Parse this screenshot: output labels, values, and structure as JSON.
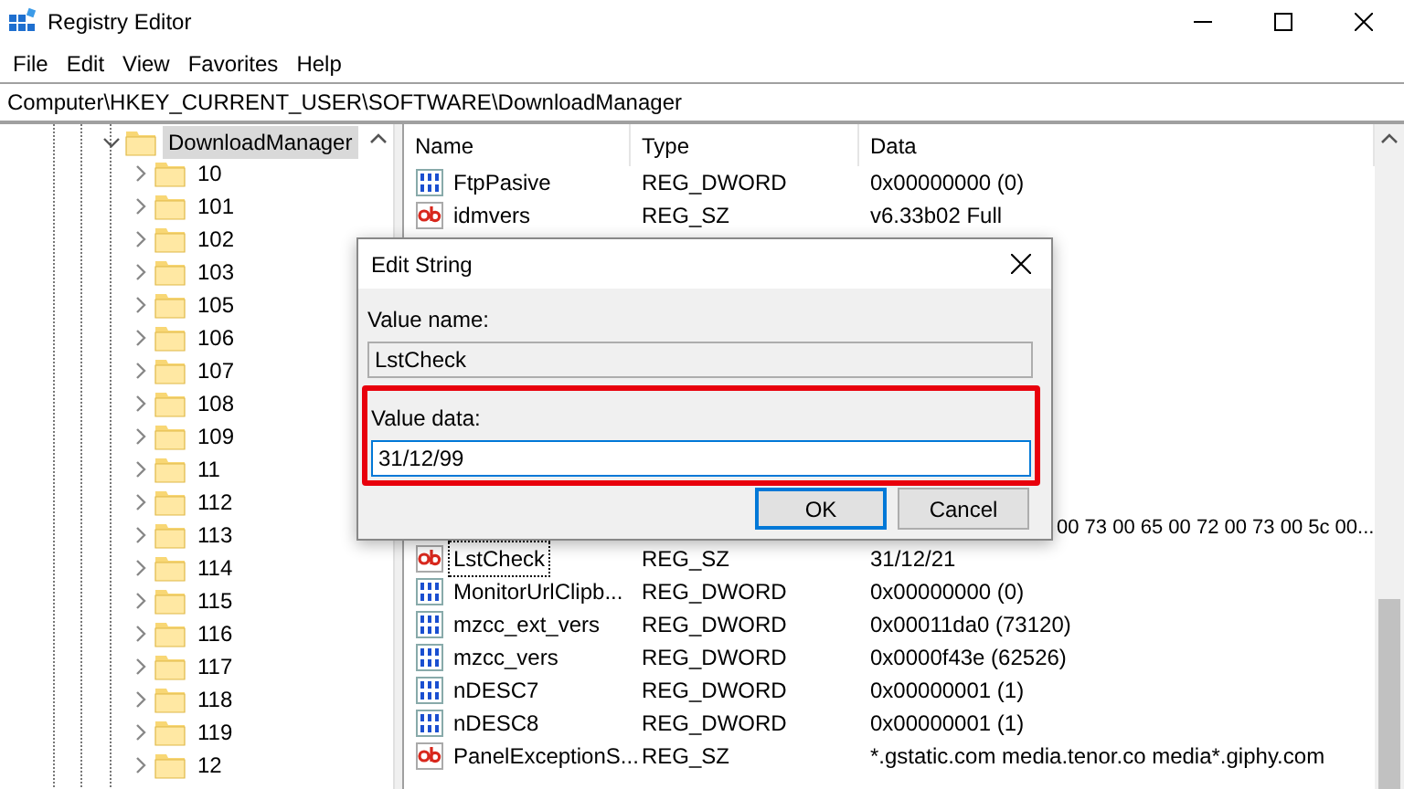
{
  "window": {
    "title": "Registry Editor"
  },
  "menu": [
    "File",
    "Edit",
    "View",
    "Favorites",
    "Help"
  ],
  "address": "Computer\\HKEY_CURRENT_USER\\SOFTWARE\\DownloadManager",
  "tree": {
    "label": "DownloadManager",
    "expanded": true,
    "selected": true,
    "children": [
      {
        "label": "10",
        "expanded": false
      },
      {
        "label": "101",
        "expanded": false
      },
      {
        "label": "102",
        "expanded": false
      },
      {
        "label": "103",
        "expanded": false
      },
      {
        "label": "105",
        "expanded": false
      },
      {
        "label": "106",
        "expanded": false
      },
      {
        "label": "107",
        "expanded": false
      },
      {
        "label": "108",
        "expanded": false
      },
      {
        "label": "109",
        "expanded": false
      },
      {
        "label": "11",
        "expanded": false
      },
      {
        "label": "112",
        "expanded": false
      },
      {
        "label": "113",
        "expanded": false
      },
      {
        "label": "114",
        "expanded": false
      },
      {
        "label": "115",
        "expanded": false
      },
      {
        "label": "116",
        "expanded": false
      },
      {
        "label": "117",
        "expanded": false
      },
      {
        "label": "118",
        "expanded": false
      },
      {
        "label": "119",
        "expanded": false
      },
      {
        "label": "12",
        "expanded": false
      }
    ]
  },
  "values": {
    "columns": [
      "Name",
      "Type",
      "Data"
    ],
    "rows": [
      {
        "kind": "dword",
        "name": "FtpPasive",
        "type": "REG_DWORD",
        "data": "0x00000000 (0)",
        "selected": false
      },
      {
        "kind": "string",
        "name": "idmvers",
        "type": "REG_SZ",
        "data": "v6.33b02 Full",
        "selected": false
      },
      {
        "kind": "partial",
        "data": "00 73 00 65 00 72 00 73 00 5c 00..."
      },
      {
        "kind": "string",
        "name": "LstCheck",
        "type": "REG_SZ",
        "data": "31/12/21",
        "selected": true
      },
      {
        "kind": "dword",
        "name": "MonitorUrlClipb...",
        "type": "REG_DWORD",
        "data": "0x00000000 (0)",
        "selected": false
      },
      {
        "kind": "dword",
        "name": "mzcc_ext_vers",
        "type": "REG_DWORD",
        "data": "0x00011da0 (73120)",
        "selected": false
      },
      {
        "kind": "dword",
        "name": "mzcc_vers",
        "type": "REG_DWORD",
        "data": "0x0000f43e (62526)",
        "selected": false
      },
      {
        "kind": "dword",
        "name": "nDESC7",
        "type": "REG_DWORD",
        "data": "0x00000001 (1)",
        "selected": false
      },
      {
        "kind": "dword",
        "name": "nDESC8",
        "type": "REG_DWORD",
        "data": "0x00000001 (1)",
        "selected": false
      },
      {
        "kind": "string",
        "name": "PanelExceptionS...",
        "type": "REG_SZ",
        "data": "*.gstatic.com media.tenor.co media*.giphy.com",
        "selected": false
      }
    ]
  },
  "dialog": {
    "title": "Edit String",
    "value_name_label": "Value name:",
    "value_name": "LstCheck",
    "value_data_label": "Value data:",
    "value_data": "31/12/99",
    "buttons": [
      {
        "label": "OK",
        "default": true
      },
      {
        "label": "Cancel",
        "default": false
      }
    ]
  }
}
